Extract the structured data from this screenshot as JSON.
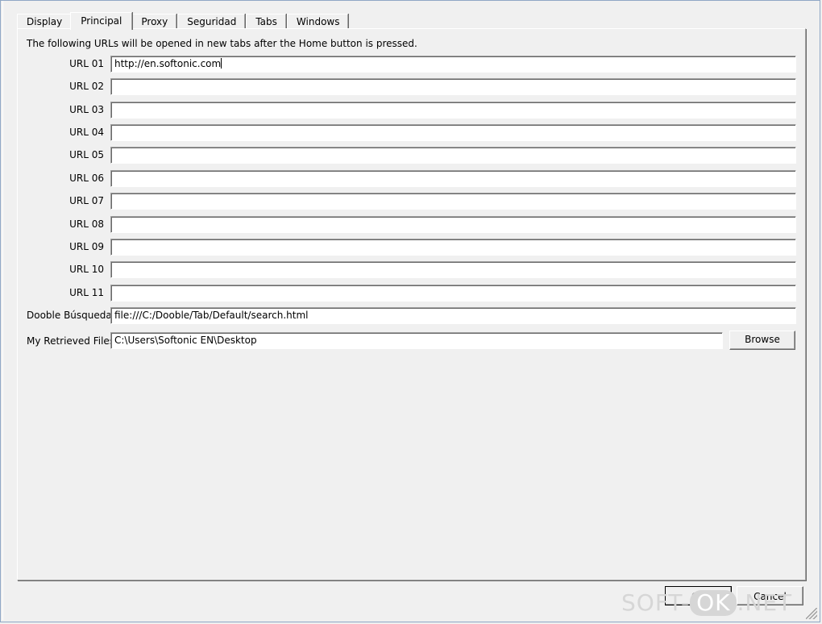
{
  "tabs": [
    {
      "label": "Display"
    },
    {
      "label": "Principal"
    },
    {
      "label": "Proxy"
    },
    {
      "label": "Seguridad"
    },
    {
      "label": "Tabs"
    },
    {
      "label": "Windows"
    }
  ],
  "active_tab": "Principal",
  "principal": {
    "intro": "The following URLs will be opened in new tabs after the Home button is pressed.",
    "urls": [
      {
        "label": "URL 01",
        "value": "http://en.softonic.com"
      },
      {
        "label": "URL 02",
        "value": ""
      },
      {
        "label": "URL 03",
        "value": ""
      },
      {
        "label": "URL 04",
        "value": ""
      },
      {
        "label": "URL 05",
        "value": ""
      },
      {
        "label": "URL 06",
        "value": ""
      },
      {
        "label": "URL 07",
        "value": ""
      },
      {
        "label": "URL 08",
        "value": ""
      },
      {
        "label": "URL 09",
        "value": ""
      },
      {
        "label": "URL 10",
        "value": ""
      },
      {
        "label": "URL 11",
        "value": ""
      }
    ],
    "search": {
      "label": "Dooble Búsqueda",
      "value": "file:///C:/Dooble/Tab/Default/search.html"
    },
    "files": {
      "label": "My Retrieved Files",
      "value": "C:\\Users\\Softonic EN\\Desktop",
      "browse_label": "Browse"
    }
  },
  "footer": {
    "ok_label": "OK",
    "cancel_label": "Cancel"
  },
  "watermark": {
    "left": "SOFT-",
    "middle": "OK",
    "right": ".NET"
  }
}
